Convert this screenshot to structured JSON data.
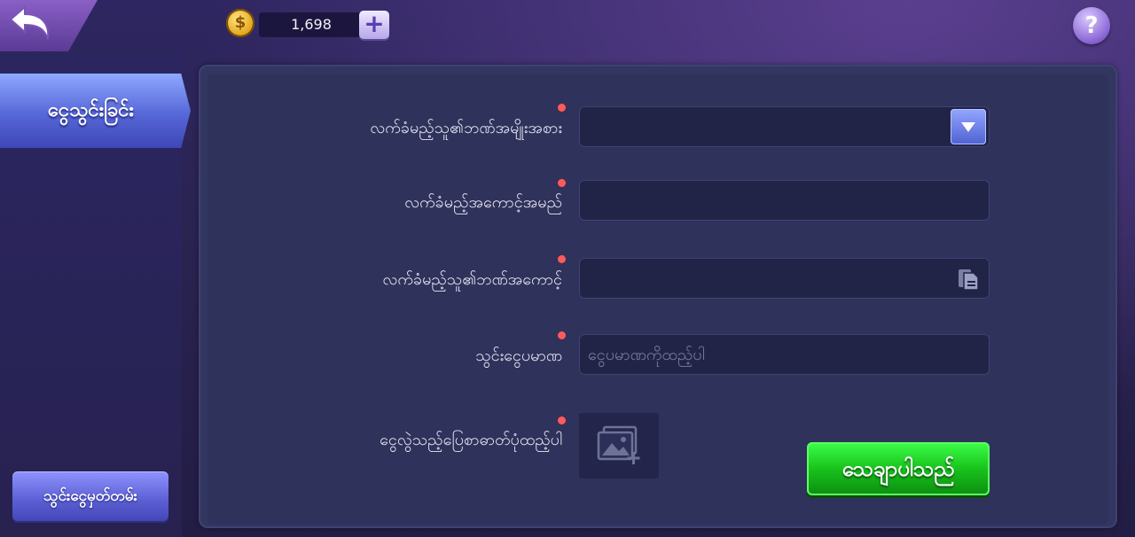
{
  "topbar": {
    "balance": "1,698",
    "plus_label": "+",
    "help_label": "?",
    "coin_symbol": "$"
  },
  "sidebar": {
    "active_tab": "ငွေသွင်းခြင်း",
    "history_button": "သွင်းငွေမှတ်တမ်း"
  },
  "form": {
    "recipient_bank_label": "လက်ခံမည့်သူ၏ဘဏ်အမျိုးအစား",
    "recipient_name_label": "လက်ခံမည့်အကောင့်အမည်",
    "recipient_account_label": "လက်ခံမည့်သူ၏ဘဏ်အကောင့်",
    "amount_label": "သွင်းငွေပမာဏ",
    "amount_placeholder": "ငွေပမာဏကိုထည့်ပါ",
    "receipt_label": "ငွေလွဲသည့်ပြေစာဓာတ်ပုံထည့်ပါ",
    "confirm_button": "သေချာပါသည်"
  },
  "colors": {
    "required_dot": "#ff5a5a",
    "confirm_green": "#18c31b",
    "tab_blue": "#5667d8"
  },
  "icons": {
    "back": "back-arrow-icon",
    "coin": "coin-icon",
    "plus": "plus-icon",
    "help": "question-icon",
    "dropdown": "chevron-down-icon",
    "paste": "paste-icon",
    "upload": "image-upload-icon"
  }
}
